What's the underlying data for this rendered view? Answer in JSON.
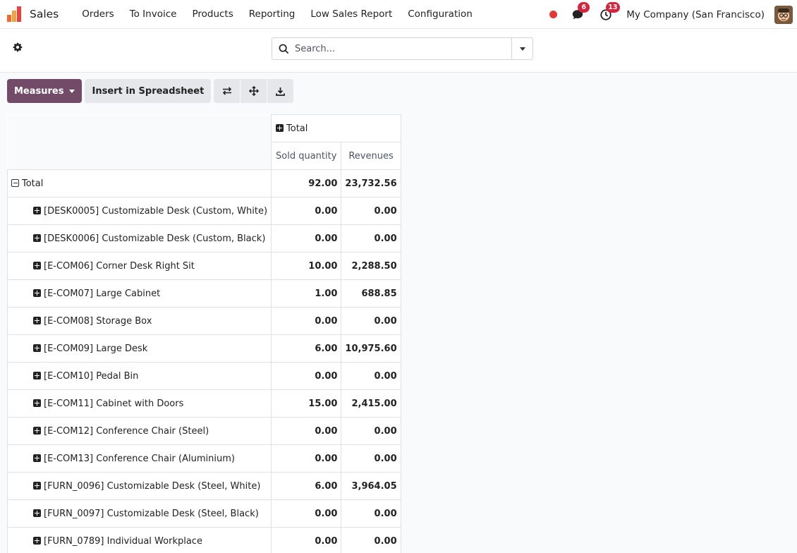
{
  "app": {
    "name": "Sales",
    "menu": [
      "Orders",
      "To Invoice",
      "Products",
      "Reporting",
      "Low Sales Report",
      "Configuration"
    ],
    "messages_count": "6",
    "activities_count": "13",
    "company": "My Company (San Francisco)"
  },
  "search": {
    "placeholder": "Search..."
  },
  "toolbar": {
    "measures_label": "Measures",
    "insert_label": "Insert in Spreadsheet"
  },
  "pivot": {
    "column_header": "Total",
    "measures": [
      "Sold quantity",
      "Revenues"
    ],
    "total_row": {
      "label": "Total",
      "qty": "92.00",
      "revenue": "23,732.56"
    },
    "rows": [
      {
        "label": "[DESK0005] Customizable Desk (Custom, White)",
        "qty": "0.00",
        "revenue": "0.00"
      },
      {
        "label": "[DESK0006] Customizable Desk (Custom, Black)",
        "qty": "0.00",
        "revenue": "0.00"
      },
      {
        "label": "[E-COM06] Corner Desk Right Sit",
        "qty": "10.00",
        "revenue": "2,288.50"
      },
      {
        "label": "[E-COM07] Large Cabinet",
        "qty": "1.00",
        "revenue": "688.85"
      },
      {
        "label": "[E-COM08] Storage Box",
        "qty": "0.00",
        "revenue": "0.00"
      },
      {
        "label": "[E-COM09] Large Desk",
        "qty": "6.00",
        "revenue": "10,975.60"
      },
      {
        "label": "[E-COM10] Pedal Bin",
        "qty": "0.00",
        "revenue": "0.00"
      },
      {
        "label": "[E-COM11] Cabinet with Doors",
        "qty": "15.00",
        "revenue": "2,415.00"
      },
      {
        "label": "[E-COM12] Conference Chair (Steel)",
        "qty": "0.00",
        "revenue": "0.00"
      },
      {
        "label": "[E-COM13] Conference Chair (Aluminium)",
        "qty": "0.00",
        "revenue": "0.00"
      },
      {
        "label": "[FURN_0096] Customizable Desk (Steel, White)",
        "qty": "6.00",
        "revenue": "3,964.05"
      },
      {
        "label": "[FURN_0097] Customizable Desk (Steel, Black)",
        "qty": "0.00",
        "revenue": "0.00"
      },
      {
        "label": "[FURN_0789] Individual Workplace",
        "qty": "0.00",
        "revenue": "0.00"
      }
    ]
  },
  "colors": {
    "primary": "#714b67",
    "badge": "#d6243d",
    "record": "#e53935"
  }
}
